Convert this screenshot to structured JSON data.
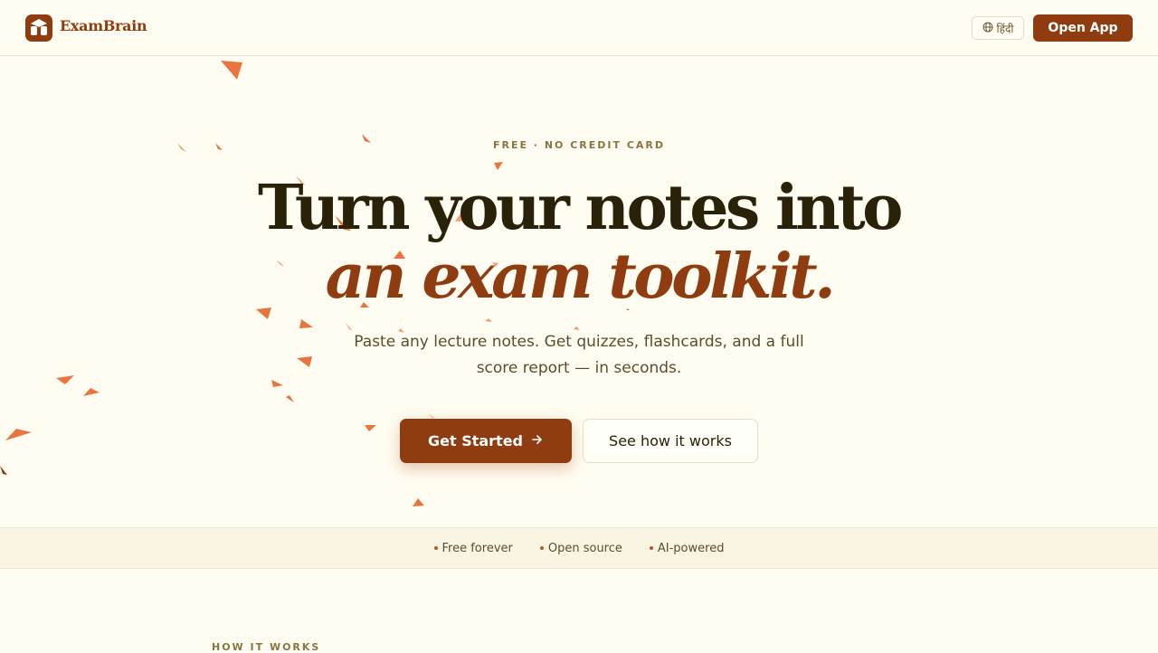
{
  "header": {
    "brand": "ExamBrain",
    "language_label": "हिंदी",
    "open_app_label": "Open App"
  },
  "hero": {
    "eyebrow": "FREE · NO CREDIT CARD",
    "headline_line1": "Turn your notes into",
    "headline_line2": "an exam toolkit.",
    "subtitle": "Paste any lecture notes. Get quizzes, flashcards, and a full score report — in seconds.",
    "primary_cta": "Get Started",
    "secondary_cta": "See how it works"
  },
  "features": [
    {
      "label": "Free forever"
    },
    {
      "label": "Open source"
    },
    {
      "label": "AI-powered"
    }
  ],
  "how_it_works": {
    "label": "HOW IT WORKS"
  },
  "colors": {
    "background": "#fffdf1",
    "brand": "#8f3d10",
    "accent_decor": "#e8753f",
    "text_dark": "#2a2208"
  },
  "icons": {
    "logo": "graduation-cap-icon",
    "language": "globe-icon",
    "cta_arrow": "arrow-right-icon",
    "decor": "paper-plane-icon"
  }
}
